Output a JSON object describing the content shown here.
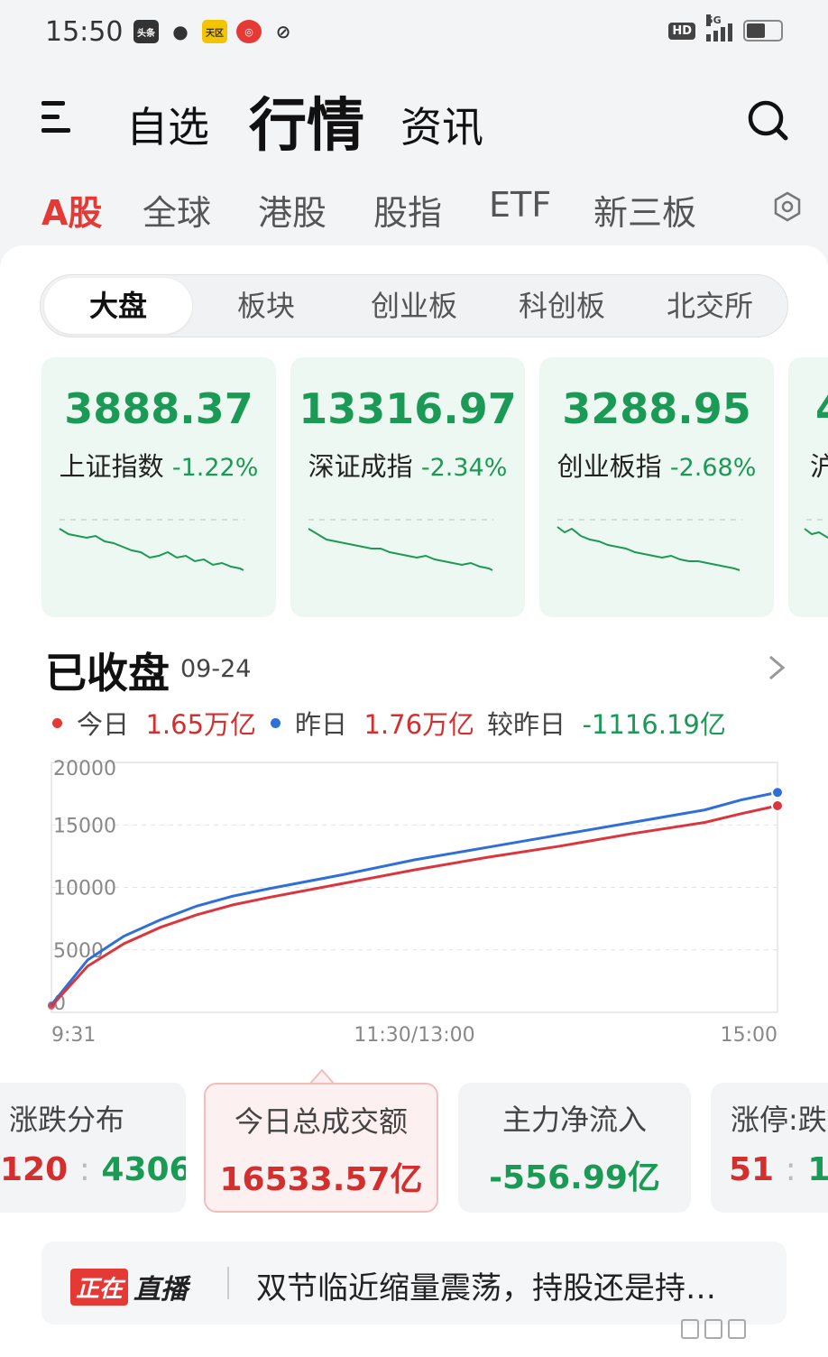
{
  "status_bar": {
    "time": "15:50",
    "notif_icons": [
      "头条",
      "wechat",
      "天区",
      "app-red",
      "link"
    ],
    "hd": "HD",
    "network": "5G"
  },
  "top_nav": {
    "tabs": [
      "自选",
      "行情",
      "资讯"
    ],
    "active_tab": "行情"
  },
  "market_tabs": {
    "items": [
      "A股",
      "全球",
      "港股",
      "股指",
      "ETF",
      "新三板"
    ],
    "active": "A股"
  },
  "segment": {
    "items": [
      "大盘",
      "板块",
      "创业板",
      "科创板",
      "北交所"
    ],
    "active": "大盘"
  },
  "indices": [
    {
      "value": "3888.37",
      "name": "上证指数",
      "change": "-1.22%"
    },
    {
      "value": "13316.97",
      "name": "深证成指",
      "change": "-2.34%"
    },
    {
      "value": "3288.95",
      "name": "创业板指",
      "change": "-2.68%"
    },
    {
      "value": "4",
      "name": "沪",
      "change": ""
    }
  ],
  "market_close": {
    "title": "已收盘",
    "date": "09-24"
  },
  "volume_legend": {
    "today_label": "今日",
    "today_value": "1.65万亿",
    "yesterday_label": "昨日",
    "yesterday_value": "1.76万亿",
    "diff_label": "较昨日",
    "diff_value": "-1116.19亿"
  },
  "chart_data": {
    "type": "line",
    "x_ticks": [
      "9:31",
      "11:30/13:00",
      "15:00"
    ],
    "y_ticks": [
      0,
      5000,
      10000,
      15000,
      20000
    ],
    "ylim": [
      0,
      20000
    ],
    "x": [
      0,
      0.05,
      0.1,
      0.15,
      0.2,
      0.25,
      0.3,
      0.4,
      0.5,
      0.6,
      0.7,
      0.8,
      0.9,
      0.95,
      1.0
    ],
    "series": [
      {
        "name": "今日",
        "color": "#d9363e",
        "values": [
          500,
          3700,
          5500,
          6800,
          7800,
          8600,
          9200,
          10300,
          11400,
          12400,
          13300,
          14300,
          15200,
          15900,
          16533
        ]
      },
      {
        "name": "昨日",
        "color": "#2f6fd6",
        "values": [
          600,
          4200,
          6100,
          7400,
          8500,
          9300,
          9900,
          11000,
          12200,
          13200,
          14200,
          15200,
          16200,
          17000,
          17600
        ]
      }
    ],
    "grid": true
  },
  "stats": [
    {
      "title": "涨跌分布",
      "value_up": "120",
      "sep": ":",
      "value_down": "4306"
    },
    {
      "title": "今日总成交额",
      "value": "16533.57亿"
    },
    {
      "title": "主力净流入",
      "value": "-556.99亿"
    },
    {
      "title": "涨停:跌",
      "value_up": "51",
      "sep": ":",
      "value_down": "1"
    }
  ],
  "live": {
    "badge_a": "正在",
    "badge_b": "直播",
    "text": "双节临近缩量震荡，持股还是持…"
  },
  "colors": {
    "accent_red": "#e53935",
    "up_red": "#d32f2f",
    "down_green": "#1a9a55",
    "blue": "#2f6fd6"
  }
}
